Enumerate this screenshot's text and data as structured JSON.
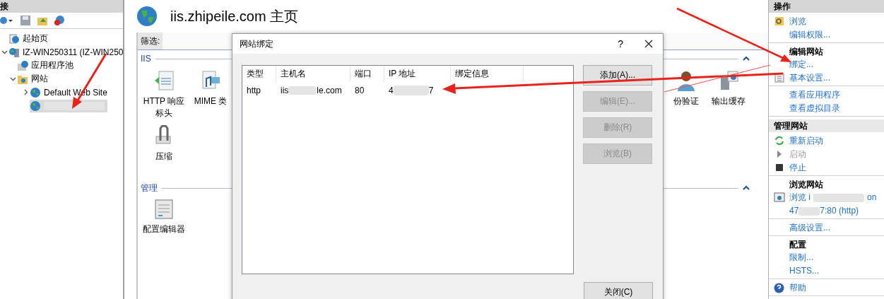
{
  "connections": {
    "title": "接",
    "tree": [
      {
        "label": "起始页",
        "kind": "start",
        "selected": false
      },
      {
        "label": "IZ-WIN250311 (IZ-WIN250",
        "kind": "server",
        "selected": false,
        "expanded": true,
        "children": [
          {
            "label": "应用程序池",
            "kind": "pool",
            "selected": false
          },
          {
            "label": "网站",
            "kind": "folder",
            "selected": false,
            "expanded": true,
            "children": [
              {
                "label": "Default Web Site",
                "kind": "site",
                "selected": false,
                "expanded": false
              },
              {
                "kind": "site",
                "redacted": true,
                "selected": true
              }
            ]
          }
        ]
      }
    ]
  },
  "page": {
    "title": "iis.zhipeile.com 主页",
    "filter_label": "筛选:",
    "groups": [
      {
        "title": "IIS",
        "expanded": true,
        "rows": [
          {
            "left": [
              {
                "label": "HTTP 响应标头",
                "kind": "headers"
              },
              {
                "label": "MIME 类",
                "kind": "mime"
              }
            ],
            "right": [
              {
                "label": "份验证",
                "kind": "user"
              },
              {
                "label": "输出缓存",
                "kind": "cache"
              }
            ]
          },
          {
            "left": [
              {
                "label": "压缩",
                "kind": "compress"
              }
            ],
            "right": []
          }
        ]
      },
      {
        "title": "管理",
        "expanded": true,
        "rows": [
          {
            "left": [
              {
                "label": "配置编辑器",
                "kind": "config"
              }
            ],
            "right": []
          }
        ]
      }
    ]
  },
  "dialog": {
    "title": "网站绑定",
    "help": "?",
    "columns": [
      "类型",
      "主机名",
      "端口",
      "IP 地址",
      "绑定信息"
    ],
    "rows": [
      {
        "type": "http",
        "host_start": "iis",
        "host_end": "le.com",
        "port": "80",
        "ip_start": "4",
        "ip_end": "7"
      }
    ],
    "buttons": [
      {
        "label": "添加(A)...",
        "disabled": false
      },
      {
        "label": "编辑(E)...",
        "disabled": true
      },
      {
        "label": "删除(R)",
        "disabled": true
      },
      {
        "label": "浏览(B)",
        "disabled": true
      }
    ],
    "close_button": "关闭(C)"
  },
  "actions": {
    "panes": [
      {
        "title": "操作",
        "sections": [
          {
            "items": [
              {
                "label": "浏览",
                "kind": "browse",
                "disabled": false
              },
              {
                "label": "编辑权限...",
                "disabled": false
              }
            ]
          },
          {
            "heading": "编辑网站",
            "items": [
              {
                "label": "绑定...",
                "disabled": false
              },
              {
                "label": "基本设置...",
                "kind": "settings",
                "disabled": false
              }
            ]
          },
          {
            "items": [
              {
                "label": "查看应用程序",
                "disabled": false
              },
              {
                "label": "查看虚拟目录",
                "disabled": false
              }
            ]
          }
        ]
      },
      {
        "title": "管理网站",
        "sections": [
          {
            "items": [
              {
                "label": "重新启动",
                "kind": "restart",
                "disabled": false
              },
              {
                "label": "启动",
                "kind": "play",
                "disabled": true
              },
              {
                "label": "停止",
                "kind": "stop",
                "disabled": false
              }
            ]
          },
          {
            "heading": "浏览网站",
            "items": [
              {
                "kind": "browser",
                "disabled": false,
                "lines": [
                  {
                    "start": "浏览 i",
                    "end": "on"
                  },
                  {
                    "start": "47",
                    "end": "7:80 (http)"
                  }
                ]
              }
            ]
          },
          {
            "items": [
              {
                "label": "高级设置...",
                "disabled": false
              }
            ]
          },
          {
            "heading": "配置",
            "items": [
              {
                "label": "限制...",
                "disabled": false
              },
              {
                "label": "HSTS...",
                "disabled": false
              }
            ]
          },
          {
            "items": [
              {
                "label": "帮助",
                "kind": "help",
                "disabled": false
              }
            ]
          }
        ]
      }
    ]
  }
}
